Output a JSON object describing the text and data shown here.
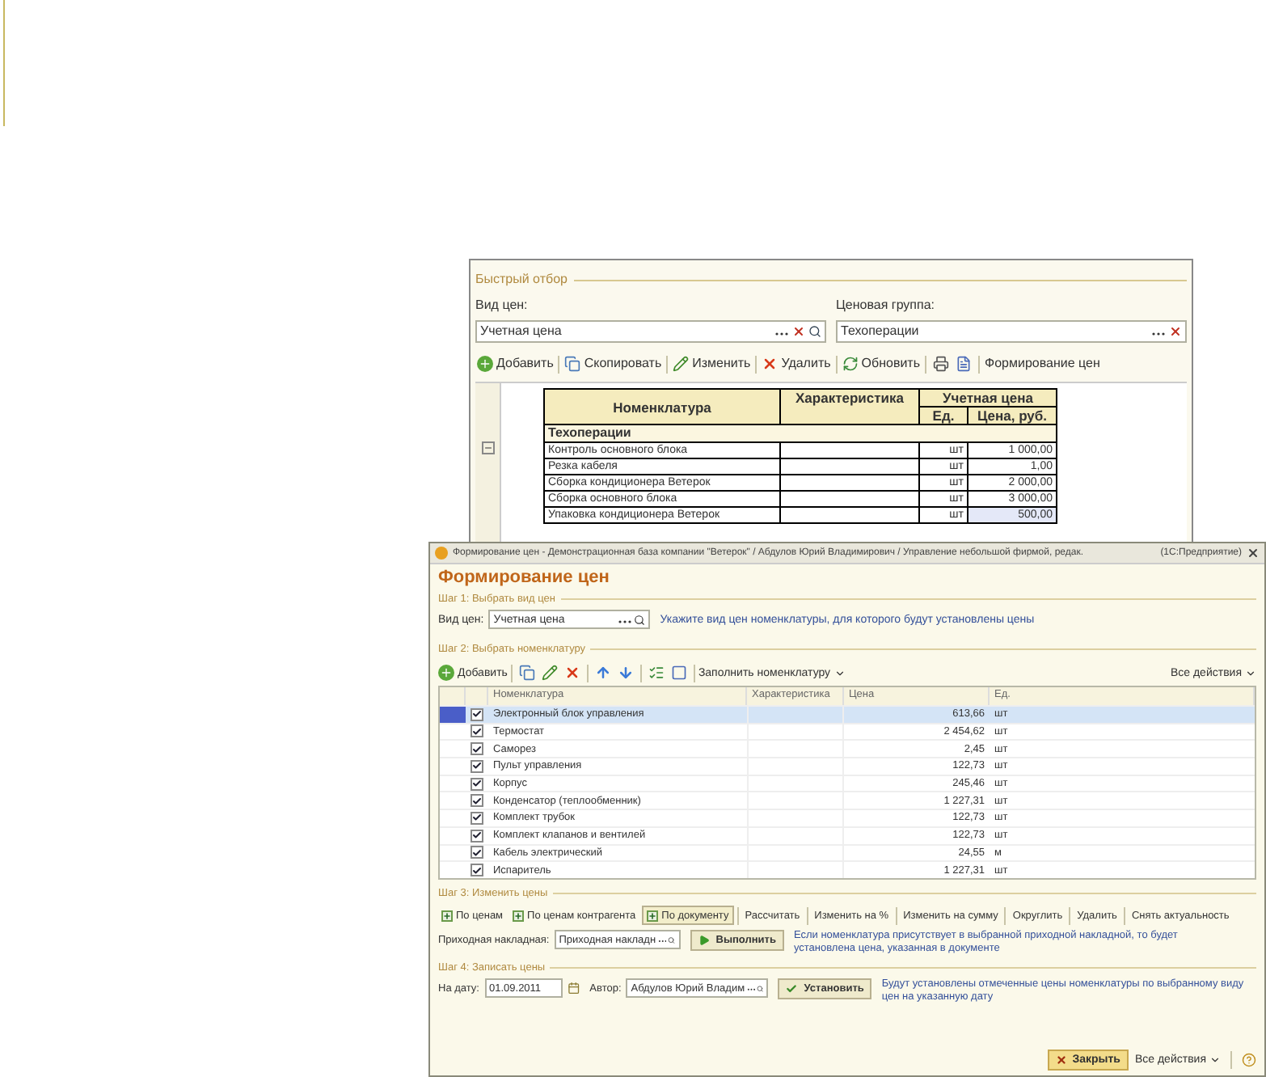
{
  "back_window": {
    "filter_title": "Быстрый отбор",
    "filters": [
      {
        "label": "Вид цен:",
        "value": "Учетная цена",
        "kind": "clearable"
      },
      {
        "label": "Ценовая группа:",
        "value": "Техоперации",
        "kind": "clearable"
      }
    ],
    "toolbar": [
      {
        "kind": "add",
        "label": "Добавить"
      },
      {
        "kind": "copy",
        "label": "Скопировать"
      },
      {
        "kind": "edit",
        "label": "Изменить"
      },
      {
        "kind": "delete",
        "label": "Удалить"
      },
      {
        "kind": "refresh",
        "label": "Обновить"
      },
      {
        "kind": "print"
      },
      {
        "kind": "report"
      },
      {
        "kind": "text",
        "label": "Формирование цен"
      }
    ],
    "report": {
      "col_name": "Номенклатура",
      "col_characteristic": "Характеристика",
      "col_group": "Учетная цена",
      "col_unit": "Ед.",
      "col_price": "Цена, руб.",
      "group": "Техоперации",
      "rows": [
        {
          "name": "Контроль основного блока",
          "unit": "шт",
          "price": "1 000,00",
          "selected": false
        },
        {
          "name": "Резка кабеля",
          "unit": "шт",
          "price": "1,00",
          "selected": false
        },
        {
          "name": "Сборка кондиционера Ветерок",
          "unit": "шт",
          "price": "2 000,00",
          "selected": false
        },
        {
          "name": "Сборка основного блока",
          "unit": "шт",
          "price": "3 000,00",
          "selected": false
        },
        {
          "name": "Упаковка кондиционера Ветерок",
          "unit": "шт",
          "price": "500,00",
          "selected": true
        }
      ]
    }
  },
  "window": {
    "title": "Формирование цен - Демонстрационная база компании \"Ветерок\" / Абдулов Юрий Владимирович / Управление небольшой фирмой, редак.",
    "app": "(1С:Предприятие)"
  },
  "heading": "Формирование цен",
  "step1": {
    "title": "Шаг 1: Выбрать вид цен",
    "label": "Вид цен:",
    "value": "Учетная цена",
    "hint": "Укажите вид цен номенклатуры, для которого будут установлены цены"
  },
  "step2": {
    "title": "Шаг 2: Выбрать номенклатуру",
    "toolbar": [
      {
        "kind": "add",
        "label": "Добавить"
      },
      {
        "kind": "copy"
      },
      {
        "kind": "edit"
      },
      {
        "kind": "delete"
      },
      {
        "kind": "up"
      },
      {
        "kind": "down"
      },
      {
        "kind": "select"
      },
      {
        "kind": "window"
      },
      {
        "kind": "menu",
        "label": "Заполнить номенклатуру"
      }
    ],
    "all_actions": "Все действия",
    "columns": [
      "Номенклатура",
      "Характеристика",
      "Цена",
      "Ед."
    ],
    "rows": [
      {
        "name": "Электронный блок управления",
        "price": "613,66",
        "unit": "шт",
        "checked": true,
        "selected": true
      },
      {
        "name": "Термостат",
        "price": "2 454,62",
        "unit": "шт",
        "checked": true,
        "selected": false
      },
      {
        "name": "Саморез",
        "price": "2,45",
        "unit": "шт",
        "checked": true,
        "selected": false
      },
      {
        "name": "Пульт управления",
        "price": "122,73",
        "unit": "шт",
        "checked": true,
        "selected": false
      },
      {
        "name": "Корпус",
        "price": "245,46",
        "unit": "шт",
        "checked": true,
        "selected": false
      },
      {
        "name": "Конденсатор (теплообменник)",
        "price": "1 227,31",
        "unit": "шт",
        "checked": true,
        "selected": false
      },
      {
        "name": "Комплект трубок",
        "price": "122,73",
        "unit": "шт",
        "checked": true,
        "selected": false
      },
      {
        "name": "Комплект клапанов и вентилей",
        "price": "122,73",
        "unit": "шт",
        "checked": true,
        "selected": false
      },
      {
        "name": "Кабель электрический",
        "price": "24,55",
        "unit": "м",
        "checked": true,
        "selected": false
      },
      {
        "name": "Испаритель",
        "price": "1 227,31",
        "unit": "шт",
        "checked": true,
        "selected": false
      }
    ]
  },
  "step3": {
    "title": "Шаг 3: Изменить цены",
    "actions": [
      {
        "kind": "icon",
        "label": "По ценам",
        "selected": false
      },
      {
        "kind": "icon",
        "label": "По ценам контрагента",
        "selected": false
      },
      {
        "kind": "icon",
        "label": "По документу",
        "selected": true
      },
      {
        "kind": "plain",
        "label": "Рассчитать",
        "selected": false
      },
      {
        "kind": "plain",
        "label": "Изменить на %",
        "selected": false
      },
      {
        "kind": "plain",
        "label": "Изменить на сумму",
        "selected": false
      },
      {
        "kind": "plain",
        "label": "Округлить",
        "selected": false
      },
      {
        "kind": "plain",
        "label": "Удалить",
        "selected": false
      },
      {
        "kind": "plain",
        "label": "Снять актуальность",
        "selected": false
      }
    ],
    "doc_label": "Приходная накладная:",
    "doc_value": "Приходная накладн",
    "run": "Выполнить",
    "hint": "Если номенклатура присутствует в выбранной приходной накладной, то будет установлена цена, указанная в документе"
  },
  "step4": {
    "title": "Шаг 4: Записать цены",
    "date_label": "На дату:",
    "date": "01.09.2011",
    "author_label": "Автор:",
    "author": "Абдулов Юрий Владим",
    "set": "Установить",
    "hint": "Будут установлены отмеченные цены номенклатуры по выбранному виду цен на указанную дату"
  },
  "footer": {
    "close": "Закрыть",
    "all_actions": "Все действия"
  }
}
